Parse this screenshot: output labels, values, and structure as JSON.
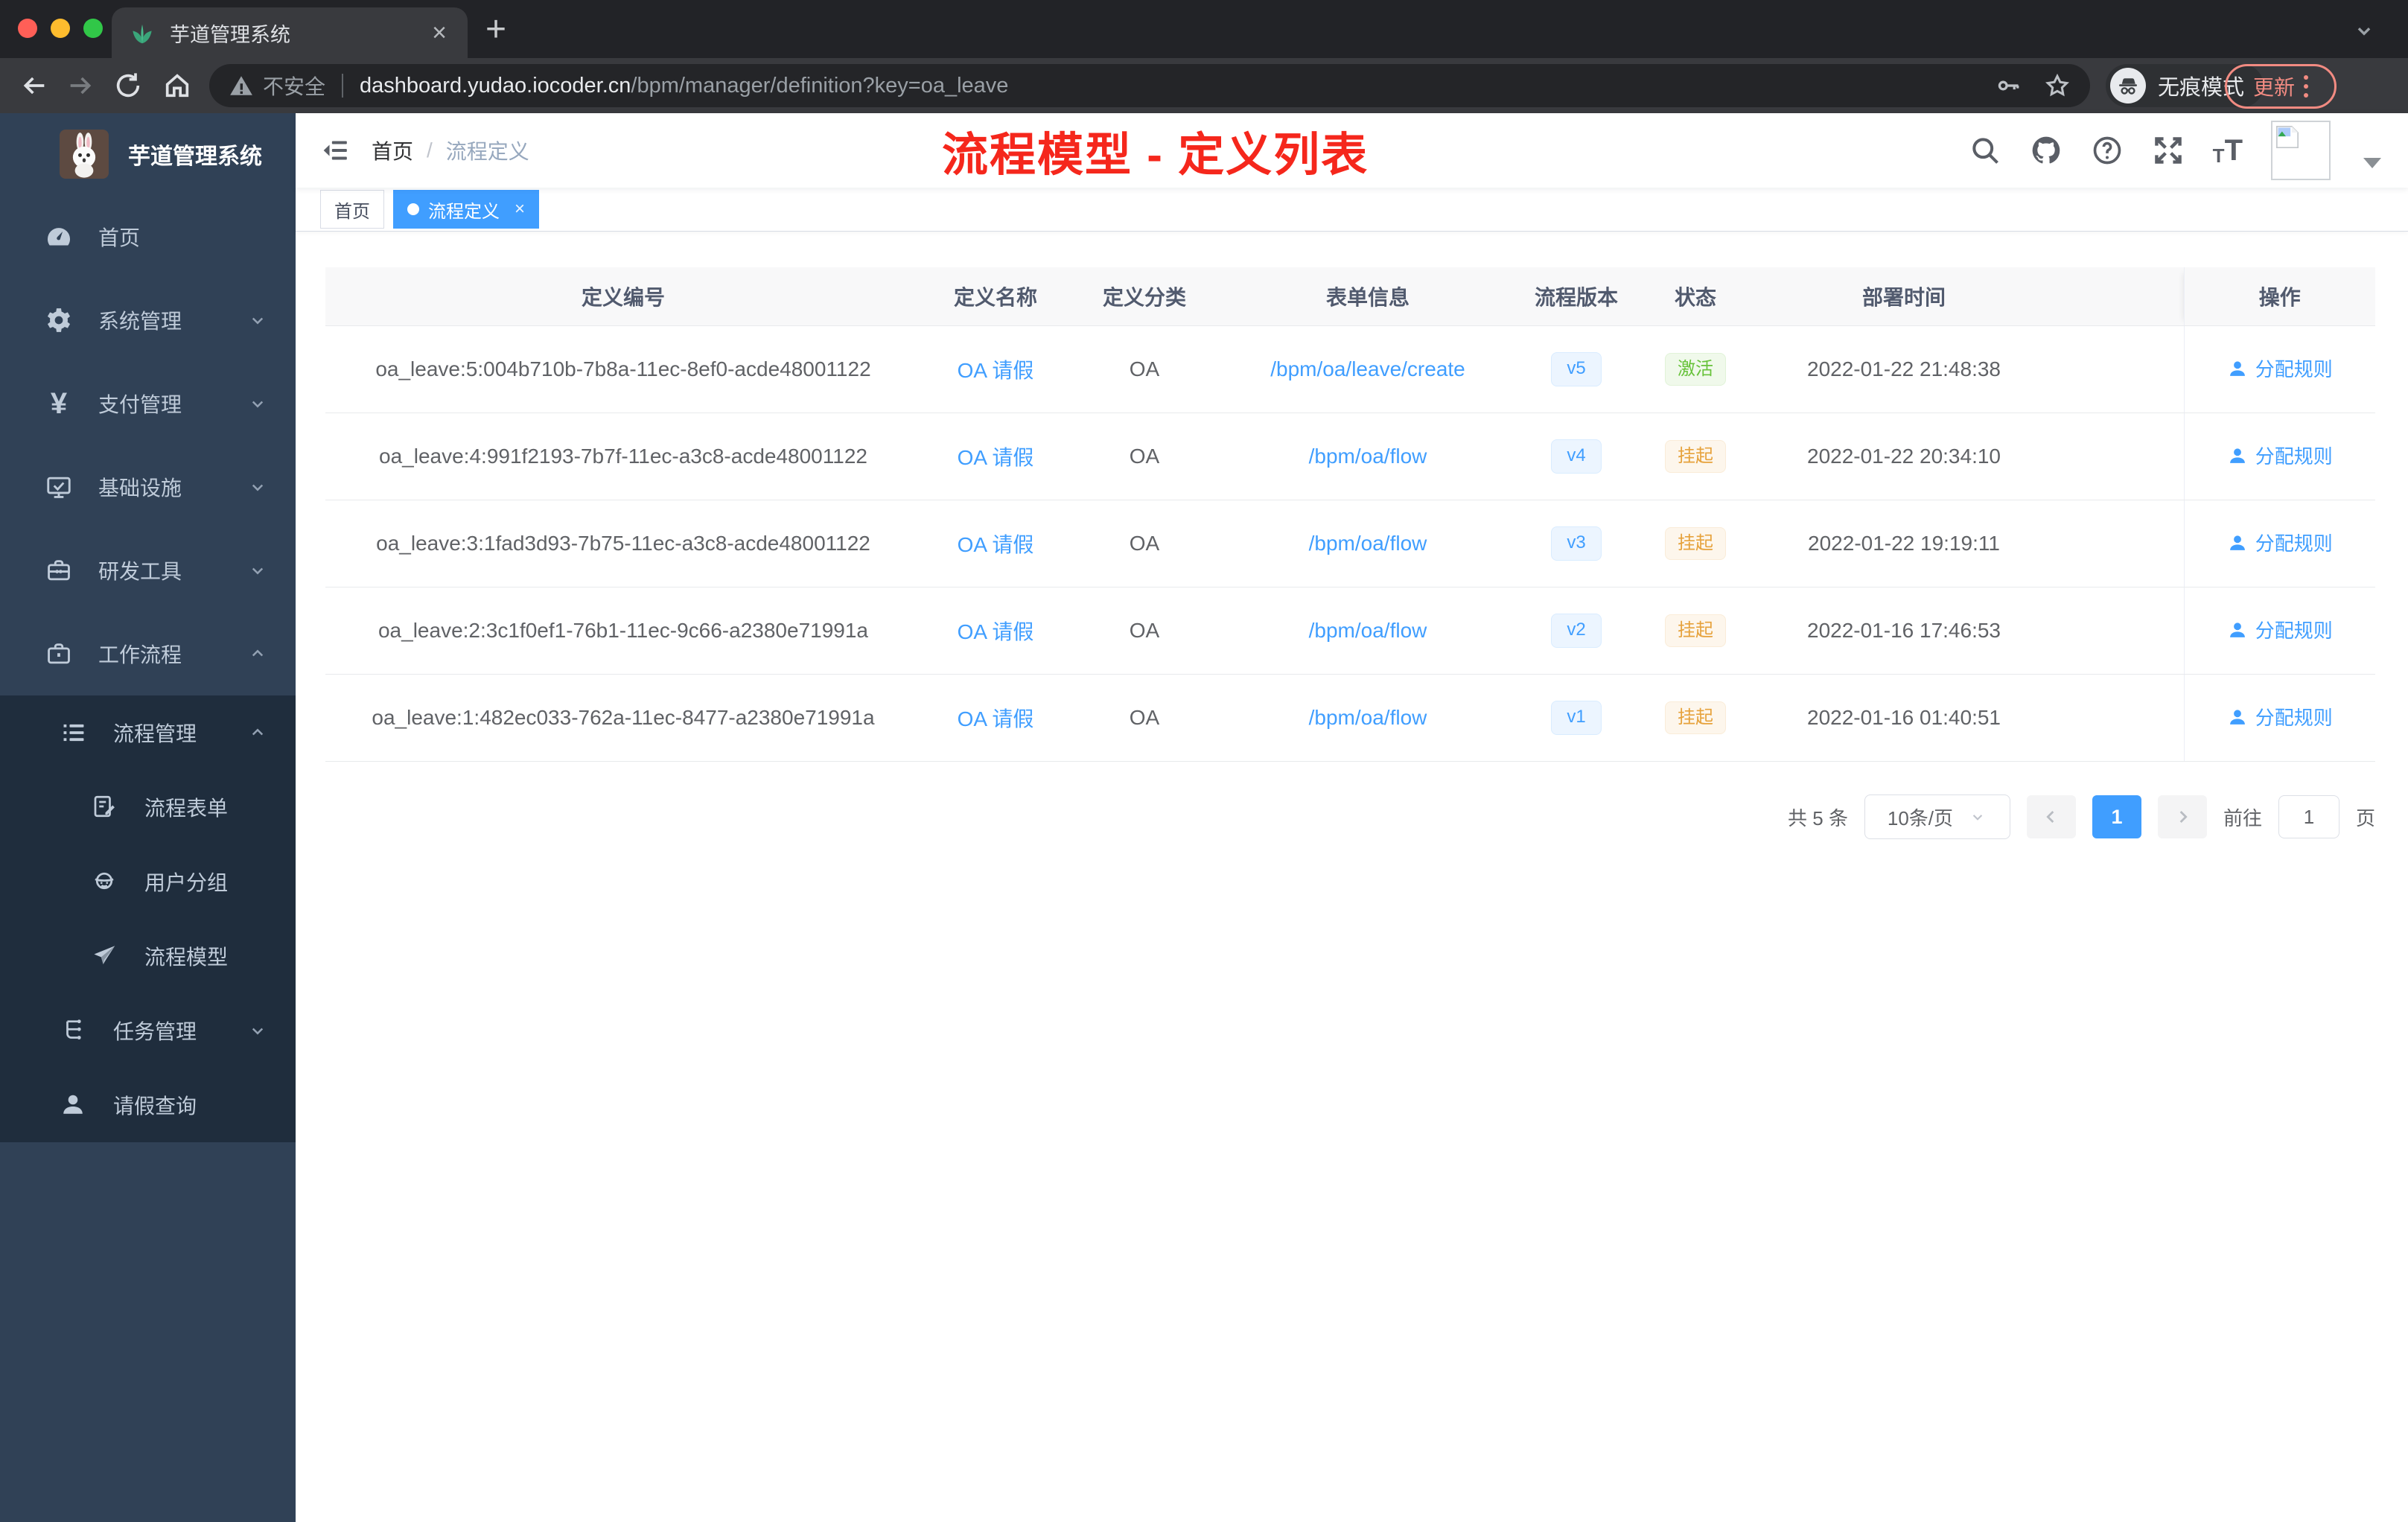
{
  "colors": {
    "accent": "#409eff",
    "success": "#67c23a",
    "warning": "#e6a23c",
    "annotation_red": "#f5271c",
    "sidebar_bg": "#304156",
    "submenu_bg": "#1f2d3d",
    "update_salmon": "#f28b82"
  },
  "browser": {
    "tab_title": "芋道管理系统",
    "close_tab": "×",
    "new_tab": "+",
    "security_label": "不安全",
    "url_domain": "dashboard.yudao.iocoder.cn",
    "url_path": "/bpm/manager/definition?key=oa_leave",
    "incognito_label": "无痕模式",
    "update_label": "更新"
  },
  "sidebar": {
    "logo_title": "芋道管理系统",
    "items": [
      {
        "label": "首页"
      },
      {
        "label": "系统管理"
      },
      {
        "label": "支付管理"
      },
      {
        "label": "基础设施"
      },
      {
        "label": "研发工具"
      },
      {
        "label": "工作流程"
      }
    ],
    "workflow_children": [
      {
        "label": "流程管理"
      },
      {
        "label": "流程表单"
      },
      {
        "label": "用户分组"
      },
      {
        "label": "流程模型"
      },
      {
        "label": "任务管理"
      },
      {
        "label": "请假查询"
      }
    ]
  },
  "navbar": {
    "breadcrumb_home": "首页",
    "breadcrumb_sep": "/",
    "breadcrumb_current": "流程定义"
  },
  "annotation": {
    "title": "流程模型 - 定义列表"
  },
  "tags": {
    "home": "首页",
    "current": "流程定义",
    "close": "×"
  },
  "table": {
    "columns": {
      "id": "定义编号",
      "name": "定义名称",
      "category": "定义分类",
      "form": "表单信息",
      "version": "流程版本",
      "status": "状态",
      "time": "部署时间",
      "action": "操作"
    },
    "rows": [
      {
        "id": "oa_leave:5:004b710b-7b8a-11ec-8ef0-acde48001122",
        "name": "OA 请假",
        "category": "OA",
        "form": "/bpm/oa/leave/create",
        "version": "v5",
        "status": "激活",
        "status_type": "success",
        "time": "2022-01-22 21:48:38",
        "action": "分配规则"
      },
      {
        "id": "oa_leave:4:991f2193-7b7f-11ec-a3c8-acde48001122",
        "name": "OA 请假",
        "category": "OA",
        "form": "/bpm/oa/flow",
        "version": "v4",
        "status": "挂起",
        "status_type": "warning",
        "time": "2022-01-22 20:34:10",
        "action": "分配规则"
      },
      {
        "id": "oa_leave:3:1fad3d93-7b75-11ec-a3c8-acde48001122",
        "name": "OA 请假",
        "category": "OA",
        "form": "/bpm/oa/flow",
        "version": "v3",
        "status": "挂起",
        "status_type": "warning",
        "time": "2022-01-22 19:19:11",
        "action": "分配规则"
      },
      {
        "id": "oa_leave:2:3c1f0ef1-76b1-11ec-9c66-a2380e71991a",
        "name": "OA 请假",
        "category": "OA",
        "form": "/bpm/oa/flow",
        "version": "v2",
        "status": "挂起",
        "status_type": "warning",
        "time": "2022-01-16 17:46:53",
        "action": "分配规则"
      },
      {
        "id": "oa_leave:1:482ec033-762a-11ec-8477-a2380e71991a",
        "name": "OA 请假",
        "category": "OA",
        "form": "/bpm/oa/flow",
        "version": "v1",
        "status": "挂起",
        "status_type": "warning",
        "time": "2022-01-16 01:40:51",
        "action": "分配规则"
      }
    ]
  },
  "pagination": {
    "total_label": "共 5 条",
    "page_size": "10条/页",
    "current_page": "1",
    "goto_label": "前往",
    "goto_value": "1",
    "page_unit": "页"
  }
}
